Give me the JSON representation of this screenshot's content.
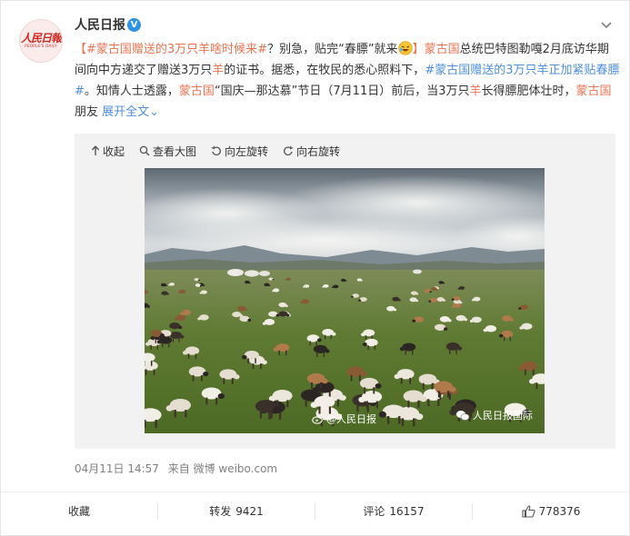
{
  "post": {
    "author": "人民日报",
    "verified_icon": "V",
    "avatar_logo_cn": "人民日報",
    "avatar_logo_en": "PEOPLE'S DAILY",
    "segments": [
      {
        "text": "【",
        "style": "hash"
      },
      {
        "text": "#蒙古国赠送的3万只羊啥时候来#",
        "style": "hash"
      },
      {
        "text": "？别急，贴完“春膘”就来",
        "style": "plain"
      },
      {
        "text": "",
        "style": "emoji"
      },
      {
        "text": "】",
        "style": "hash"
      },
      {
        "text": "蒙古国",
        "style": "hash"
      },
      {
        "text": "总统巴特图勒嘎2月底访华期间向中方递交了赠送3万只",
        "style": "plain"
      },
      {
        "text": "羊",
        "style": "hash"
      },
      {
        "text": "的证书。据悉，在牧民的悉心照料下，",
        "style": "plain"
      },
      {
        "text": "#蒙古国赠送的3万只羊正加紧贴春膘#",
        "style": "blue"
      },
      {
        "text": "。知情人士透露，",
        "style": "plain"
      },
      {
        "text": "蒙古国",
        "style": "hash"
      },
      {
        "text": "“国庆—那达慕”节日（7月11日）前后，当3万只",
        "style": "plain"
      },
      {
        "text": "羊",
        "style": "hash"
      },
      {
        "text": "长得膘肥体壮时，",
        "style": "plain"
      },
      {
        "text": "蒙古国",
        "style": "hash"
      },
      {
        "text": "朋友 ",
        "style": "plain"
      },
      {
        "text": "展开全文",
        "style": "blue"
      },
      {
        "text": "⌄",
        "style": "blue"
      }
    ],
    "timestamp": "04月11日 14:57",
    "source": "来自 微博 weibo.com"
  },
  "media_toolbar": {
    "collapse": "收起",
    "view_large": "查看大图",
    "rotate_left": "向左旋转",
    "rotate_right": "向右旋转"
  },
  "photo": {
    "watermark_weibo": "@人民日报",
    "watermark_wechat": "人民日报国际"
  },
  "actions": {
    "favorite": "收藏",
    "repost_label": "转发",
    "repost_count": "9421",
    "comment_label": "评论",
    "comment_count": "16157",
    "like_count": "778376"
  },
  "colors": {
    "topic": "#eb7350",
    "link": "#4d8fd8",
    "verified": "#2d93e6",
    "meta_gray": "#808080"
  }
}
